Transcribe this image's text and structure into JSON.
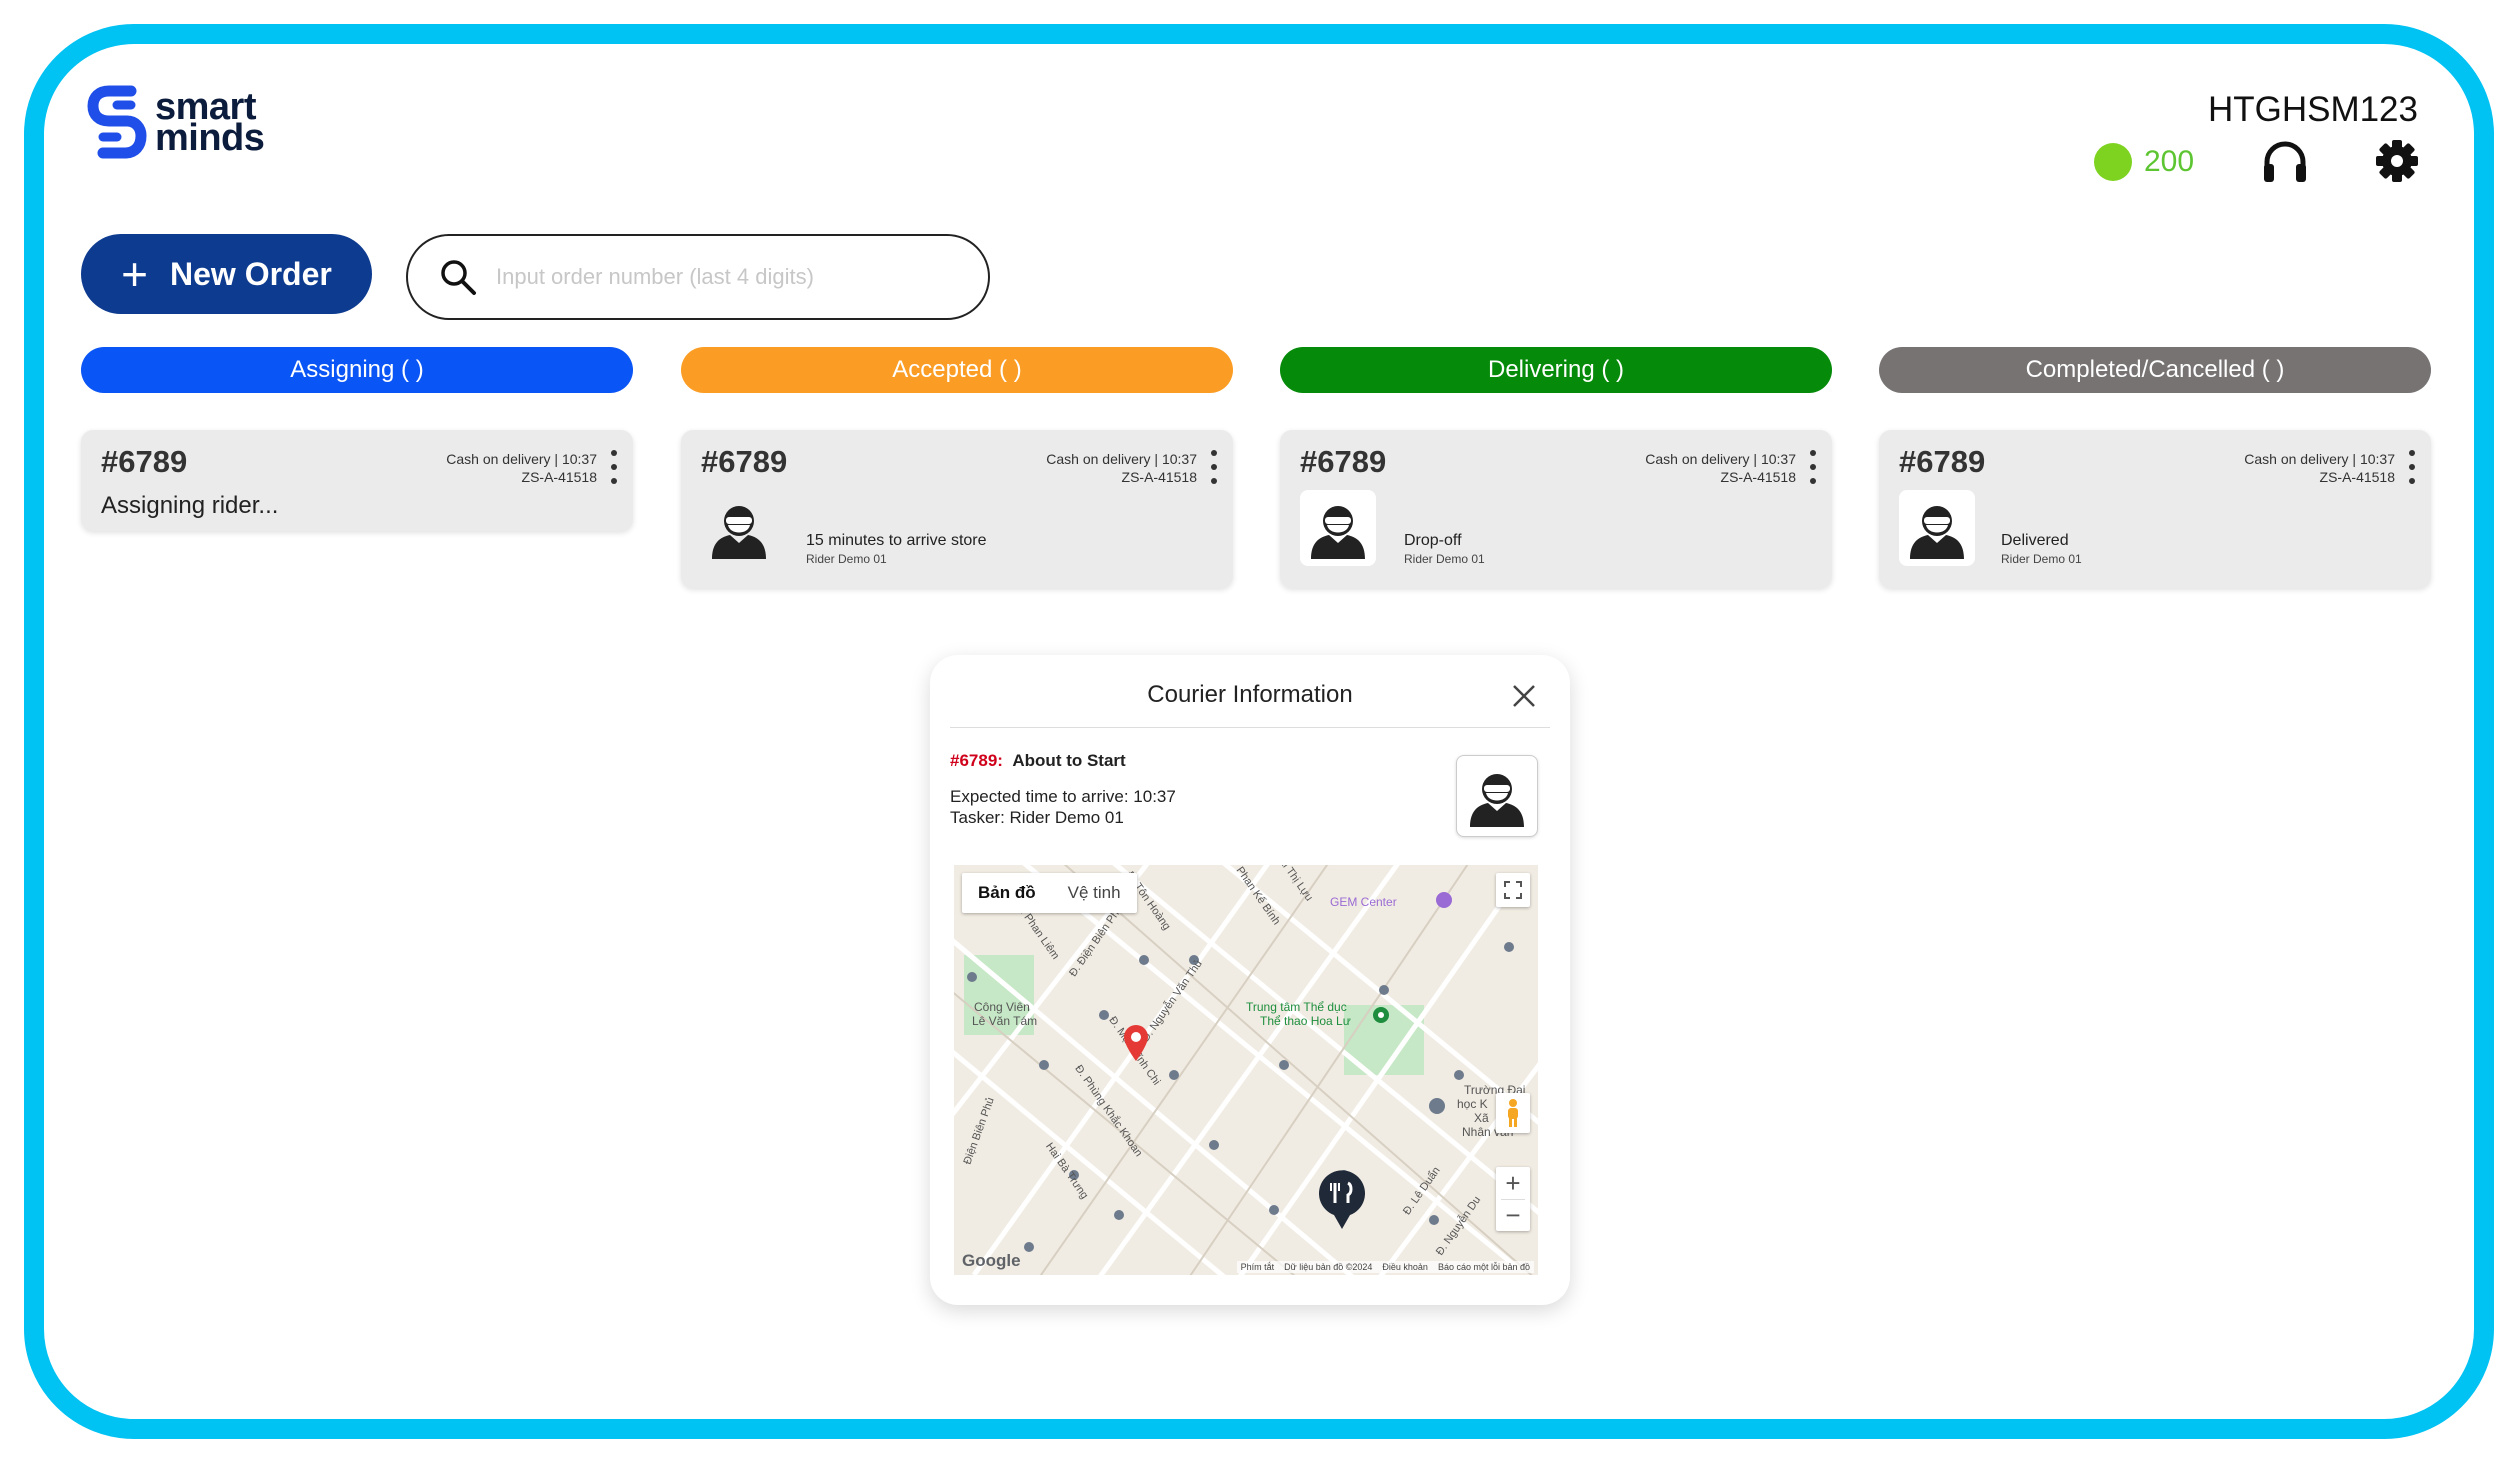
{
  "brand": {
    "name_line1": "smart",
    "name_line2": "minds",
    "color": "#1f4fe8"
  },
  "header": {
    "user_id": "HTGHSM123",
    "credit": "200",
    "support_icon": "headset-icon",
    "settings_icon": "gear-icon"
  },
  "toolbar": {
    "new_order_label": "New Order",
    "search_placeholder": "Input order number (last 4 digits)"
  },
  "columns": [
    {
      "label": "Assigning (  )",
      "color": "#0a55f5"
    },
    {
      "label": "Accepted (  )",
      "color": "#fb9d24"
    },
    {
      "label": "Delivering (  )",
      "color": "#068a0a"
    },
    {
      "label": "Completed/Cancelled (  )",
      "color": "#777373"
    }
  ],
  "cards": [
    {
      "order": "#6789",
      "meta_line1": "Cash on delivery | 10:37",
      "meta_line2": "ZS-A-41518",
      "status": "Assigning rider..."
    },
    {
      "order": "#6789",
      "meta_line1": "Cash on delivery | 10:37",
      "meta_line2": "ZS-A-41518",
      "status": "15 minutes to arrive store",
      "rider": "Rider Demo 01"
    },
    {
      "order": "#6789",
      "meta_line1": "Cash on delivery | 10:37",
      "meta_line2": "ZS-A-41518",
      "status": "Drop-off",
      "rider": "Rider Demo 01"
    },
    {
      "order": "#6789",
      "meta_line1": "Cash on delivery | 10:37",
      "meta_line2": "ZS-A-41518",
      "status": "Delivered",
      "rider": "Rider Demo 01"
    }
  ],
  "modal": {
    "title": "Courier Information",
    "order": "#6789:",
    "status": "About to Start",
    "expected": "Expected time to arrive: 10:37",
    "tasker": "Tasker: Rider Demo 01"
  },
  "map": {
    "tab_map": "Bản đồ",
    "tab_satellite": "Vệ tinh",
    "labels": {
      "gem_center": "GEM Center",
      "park_line1": "Công Viên",
      "park_line2": "Lê Văn Tám",
      "sports_line1": "Trung tâm Thể dục",
      "sports_line2": "Thể thao Hoa Lư",
      "school_line1": "Trường Đại",
      "school_line2": "học K",
      "school_line3": "Xã",
      "school_line4": "Nhân văn",
      "street1": "Đ. Phan Liêm",
      "street2": "Đ. Điện Biên Phủ",
      "street3": "Đ. Nguyễn Văn Thủ",
      "street4": "Đ. Mạc Đĩnh Chi",
      "street5": "Đ. Phùng Khắc Khoan",
      "street6": "Hai Bà Trưng",
      "street7": "Đ. Lê Duẩn",
      "street8": "Đ. Nguyễn Du",
      "street9": "Đ. Tôn Hoàng",
      "street10": "Phan Kế Bính",
      "street11": "Mai Thị Lựu",
      "street12": "Điện Biên Phủ"
    },
    "google": "Google",
    "footer": [
      "Phím tắt",
      "Dữ liệu bản đồ ©2024",
      "Điều khoản",
      "Báo cáo một lỗi bản đồ"
    ]
  }
}
